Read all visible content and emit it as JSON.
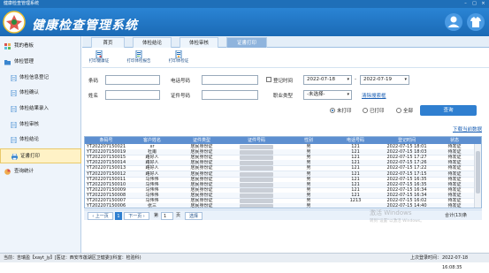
{
  "window": {
    "title": "健康检查管理系统"
  },
  "header": {
    "app_title": "健康检查管理系统"
  },
  "sidebar": {
    "items": [
      {
        "label": "我的看板",
        "level": 0,
        "icon": "dashboard-icon",
        "active": false
      },
      {
        "label": "体检管理",
        "level": 0,
        "icon": "folder-icon",
        "active": false
      },
      {
        "label": "体检信息登记",
        "level": 1,
        "icon": "doc-icon",
        "active": false
      },
      {
        "label": "体检确认",
        "level": 1,
        "icon": "doc-icon",
        "active": false
      },
      {
        "label": "体检结果录入",
        "level": 1,
        "icon": "doc-icon",
        "active": false
      },
      {
        "label": "体检审核",
        "level": 1,
        "icon": "doc-icon",
        "active": false
      },
      {
        "label": "体检结论",
        "level": 1,
        "icon": "doc-icon",
        "active": false
      },
      {
        "label": "证書打印",
        "level": 1,
        "icon": "print-icon",
        "active": true
      },
      {
        "label": "查询统计",
        "level": 0,
        "icon": "chart-icon",
        "active": false
      }
    ]
  },
  "tabs": [
    {
      "label": "首页",
      "active": false
    },
    {
      "label": "体检结论",
      "active": false
    },
    {
      "label": "体检审核",
      "active": false
    },
    {
      "label": "证書打印",
      "active": true
    }
  ],
  "toolbar": {
    "buttons": [
      {
        "label": "打印健康证"
      },
      {
        "label": "打印体检报告"
      },
      {
        "label": "打印体检证"
      }
    ]
  },
  "form": {
    "barcode_label": "条码",
    "phone_label": "电话号码",
    "reg_time_label": "登记时间",
    "date_from": "2022-07-18",
    "date_sep": "-",
    "date_to": "2022-07-19",
    "name_label": "姓名",
    "id_label": "证件号码",
    "job_label": "职业类型",
    "job_value": "-未选择-",
    "clear_link": "清除搜索框",
    "status_options": [
      {
        "label": "未打印",
        "selected": true
      },
      {
        "label": "已打印",
        "selected": false
      },
      {
        "label": "全部",
        "selected": false
      }
    ],
    "query_button": "查询",
    "download_link": "下载当前数据"
  },
  "grid": {
    "columns": [
      "条码号",
      "客户姓名",
      "证件类型",
      "证件号码",
      "性别",
      "电话号码",
      "登记时间",
      "状态"
    ],
    "rows": [
      {
        "barcode": "YT202207150021",
        "name": "xr",
        "idtype": "居民身份证",
        "gender": "男",
        "phone": "121",
        "time": "2022-07-15 18:01",
        "status": "待发证"
      },
      {
        "barcode": "YT202207150019",
        "name": "杜甫",
        "idtype": "居民身份证",
        "gender": "男",
        "phone": "121",
        "time": "2022-07-15 18:03",
        "status": "待发证"
      },
      {
        "barcode": "YT202207150015",
        "name": "路好人",
        "idtype": "居民身份证",
        "gender": "男",
        "phone": "121",
        "time": "2022-07-15 17:27",
        "status": "待发证"
      },
      {
        "barcode": "YT202207150014",
        "name": "路好人",
        "idtype": "居民身份证",
        "gender": "男",
        "phone": "121",
        "time": "2022-07-15 17:26",
        "status": "待发证"
      },
      {
        "barcode": "YT202207150013",
        "name": "路好人",
        "idtype": "居民身份证",
        "gender": "男",
        "phone": "121",
        "time": "2022-07-15 17:22",
        "status": "待发证"
      },
      {
        "barcode": "YT202207150012",
        "name": "路好人",
        "idtype": "居民身份证",
        "gender": "男",
        "phone": "121",
        "time": "2022-07-15 17:15",
        "status": "待发证"
      },
      {
        "barcode": "YT202207150011",
        "name": "马伟伟",
        "idtype": "居民身份证",
        "gender": "男",
        "phone": "121",
        "time": "2022-07-15 16:35",
        "status": "待发证"
      },
      {
        "barcode": "YT202207150010",
        "name": "马伟伟",
        "idtype": "居民身份证",
        "gender": "男",
        "phone": "121",
        "time": "2022-07-15 16:35",
        "status": "待发证"
      },
      {
        "barcode": "YT202207150009",
        "name": "马伟伟",
        "idtype": "居民身份证",
        "gender": "男",
        "phone": "121",
        "time": "2022-07-15 16:34",
        "status": "待发证"
      },
      {
        "barcode": "YT202207150008",
        "name": "马伟伟",
        "idtype": "居民身份证",
        "gender": "男",
        "phone": "121",
        "time": "2022-07-15 16:34",
        "status": "待发证"
      },
      {
        "barcode": "YT202207150007",
        "name": "马伟伟",
        "idtype": "居民身份证",
        "gender": "男",
        "phone": "1213",
        "time": "2022-07-15 16:02",
        "status": "待发证"
      },
      {
        "barcode": "YT202207150006",
        "name": "张三",
        "idtype": "居民身份证",
        "gender": "男",
        "phone": "",
        "time": "2022-07-15 14:40",
        "status": "待发证"
      }
    ]
  },
  "pager": {
    "prev": "上一页",
    "page": "1",
    "next": "下一页",
    "goto_prefix": "第",
    "goto_value": "1",
    "goto_suffix": "页",
    "goto_button": "选择",
    "total": "合计(13)条"
  },
  "status": {
    "left": "当前：吉瑞盈【xayt_jy】[医证：西安市莲湖区卫健委](科室：检验科)",
    "login_label": "上次登录时间：",
    "login_time": "2022-07-18 16:08:35"
  },
  "watermark": {
    "line1": "激活 Windows",
    "line2": "转到\"设置\"以激活 Windows。"
  },
  "colors": {
    "header": "#1b6ab5",
    "accent": "#2f7fd0",
    "grid_header": "#5d8fd0",
    "active_sidebar": "#fff2c6"
  }
}
